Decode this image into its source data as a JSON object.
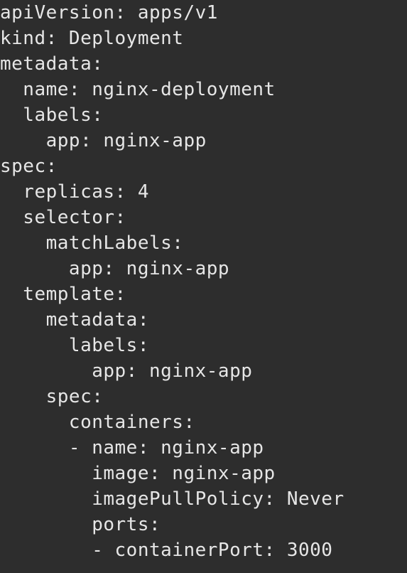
{
  "colors": {
    "background": "#2d2d2d",
    "text": "#e6e6e6"
  },
  "editor": {
    "lines": [
      "apiVersion: apps/v1",
      "kind: Deployment",
      "metadata:",
      "  name: nginx-deployment",
      "  labels:",
      "    app: nginx-app",
      "spec:",
      "  replicas: 4",
      "  selector:",
      "    matchLabels:",
      "      app: nginx-app",
      "  template:",
      "    metadata:",
      "      labels:",
      "        app: nginx-app",
      "    spec:",
      "      containers:",
      "      - name: nginx-app",
      "        image: nginx-app",
      "        imagePullPolicy: Never",
      "        ports:",
      "        - containerPort: 3000"
    ]
  }
}
